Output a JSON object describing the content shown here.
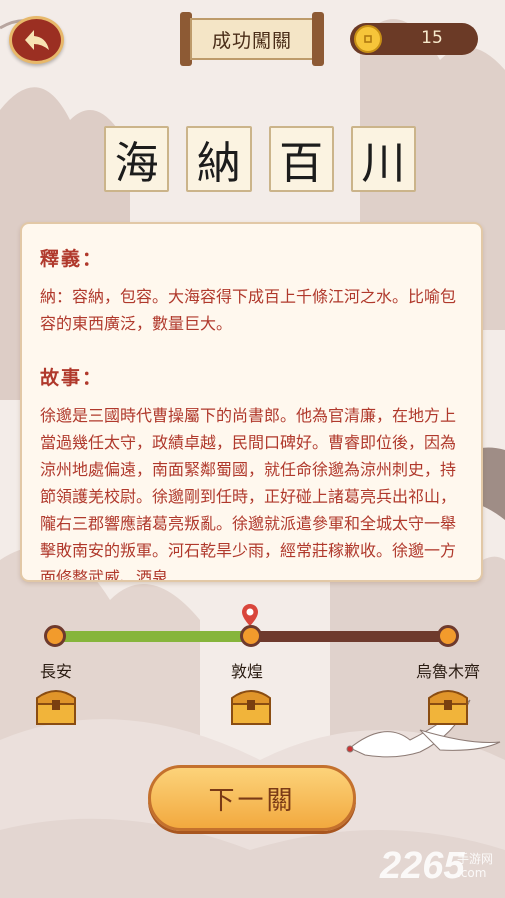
{
  "header": {
    "back_icon": "back-arrow-icon",
    "title": "成功闖關",
    "coin_icon": "coin-icon",
    "coin_count": "15"
  },
  "idiom": {
    "characters": [
      "海",
      "納",
      "百",
      "川"
    ]
  },
  "meaning": {
    "heading": "釋義：",
    "text": "納：容納，包容。大海容得下成百上千條江河之水。比喻包容的東西廣泛，數量巨大。"
  },
  "story": {
    "heading": "故事：",
    "text": "徐邈是三國時代曹操屬下的尚書郎。他為官清廉，在地方上當過幾任太守，政績卓越，民間口碑好。曹睿即位後，因為涼州地處偏遠，南面緊鄰蜀國，就任命徐邈為涼州刺史，持節領護羌校尉。徐邈剛到任時，正好碰上諸葛亮兵出祁山，隴右三郡響應諸葛亮叛亂。徐邈就派遣參軍和全城太守一舉擊敗南安的叛軍。河石乾旱少雨，經常莊稼歉收。徐邈一方面修整武威、酒泉"
  },
  "progress": {
    "value": 0.5,
    "stops": [
      {
        "name": "長安",
        "chest_icon": "treasure-chest-icon"
      },
      {
        "name": "敦煌",
        "chest_icon": "treasure-chest-icon"
      },
      {
        "name": "烏魯木齊",
        "chest_icon": "treasure-chest-icon"
      }
    ],
    "marker_icon": "location-pin-icon"
  },
  "next_button": "下一關",
  "watermark": {
    "main": "2265",
    "suffix": ".com",
    "label": "手游网"
  },
  "colors": {
    "accent": "#b0392c",
    "progress_fill": "#86b53b",
    "track": "#6e3a2d",
    "button": "#f2a93f"
  }
}
